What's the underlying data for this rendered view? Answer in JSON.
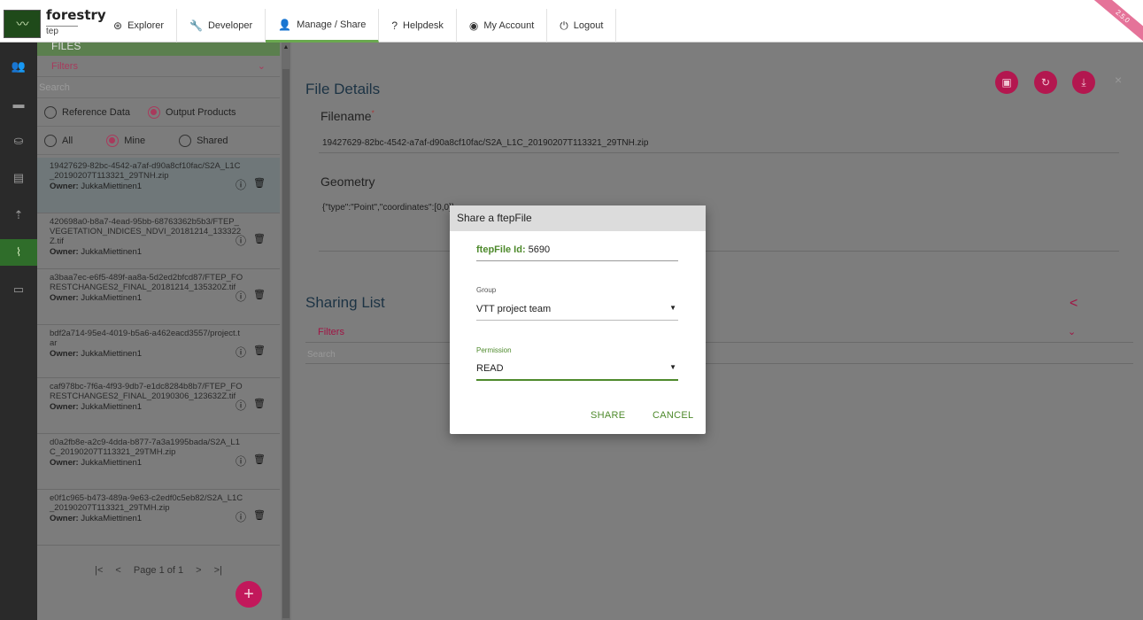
{
  "brand": {
    "logo": "〰",
    "name": "forestry",
    "sub": "tep"
  },
  "nav": [
    {
      "icon": "compass-icon",
      "glyph": "⊛",
      "label": "Explorer",
      "active": false
    },
    {
      "icon": "wrench-icon",
      "glyph": "🔧",
      "label": "Developer",
      "active": false
    },
    {
      "icon": "user-icon",
      "glyph": "👤",
      "label": "Manage / Share",
      "active": true
    },
    {
      "icon": "help-icon",
      "glyph": "?",
      "label": "Helpdesk",
      "active": false
    },
    {
      "icon": "account-icon",
      "glyph": "◉",
      "label": "My Account",
      "active": false
    },
    {
      "icon": "power-icon",
      "glyph": "⏻",
      "label": "Logout",
      "active": false
    }
  ],
  "version": "2.5.0",
  "rail": [
    {
      "icon": "groups-icon",
      "glyph": "👥"
    },
    {
      "icon": "folder-icon",
      "glyph": "▬"
    },
    {
      "icon": "basket-icon",
      "glyph": "⛀"
    },
    {
      "icon": "clipboard-icon",
      "glyph": "▤"
    },
    {
      "icon": "antenna-icon",
      "glyph": "⇡"
    },
    {
      "icon": "paperclip-icon",
      "glyph": "⌇",
      "active": true
    },
    {
      "icon": "chat-icon",
      "glyph": "▭"
    }
  ],
  "files": {
    "header": "FILES",
    "filters_label": "Filters",
    "search_placeholder": "Search",
    "type_options": [
      {
        "label": "Reference Data",
        "checked": false
      },
      {
        "label": "Output Products",
        "checked": true
      }
    ],
    "owner_options": [
      {
        "label": "All",
        "checked": false
      },
      {
        "label": "Mine",
        "checked": true
      },
      {
        "label": "Shared",
        "checked": false
      }
    ],
    "owner_prefix": "Owner:",
    "items": [
      {
        "name": "19427629-82bc-4542-a7af-d90a8cf10fac/S2A_L1C_20190207T113321_29TNH.zip",
        "owner": "JukkaMiettinen1",
        "selected": true
      },
      {
        "name": "420698a0-b8a7-4ead-95bb-68763362b5b3/FTEP_VEGETATION_INDICES_NDVI_20181214_133322Z.tif",
        "owner": "JukkaMiettinen1",
        "selected": false
      },
      {
        "name": "a3baa7ec-e6f5-489f-aa8a-5d2ed2bfcd87/FTEP_FORESTCHANGES2_FINAL_20181214_135320Z.tif",
        "owner": "JukkaMiettinen1",
        "selected": false
      },
      {
        "name": "bdf2a714-95e4-4019-b5a6-a462eacd3557/project.tar",
        "owner": "JukkaMiettinen1",
        "selected": false
      },
      {
        "name": "caf978bc-7f6a-4f93-9db7-e1dc8284b8b7/FTEP_FORESTCHANGES2_FINAL_20190306_123632Z.tif",
        "owner": "JukkaMiettinen1",
        "selected": false
      },
      {
        "name": "d0a2fb8e-a2c9-4dda-b877-7a3a1995bada/S2A_L1C_20190207T113321_29TMH.zip",
        "owner": "JukkaMiettinen1",
        "selected": false
      },
      {
        "name": "e0f1c965-b473-489a-9e63-c2edf0c5eb82/S2A_L1C_20190207T113321_29TMH.zip",
        "owner": "JukkaMiettinen1",
        "selected": false
      }
    ],
    "pager": {
      "first": "|<",
      "prev": "<",
      "page_text": "Page 1 of 1",
      "next": ">",
      "last": ">|"
    },
    "add_glyph": "+"
  },
  "details": {
    "title": "File Details",
    "filename_label": "Filename",
    "required_mark": "*",
    "filename_value": "19427629-82bc-4542-a7af-d90a8cf10fac/S2A_L1C_20190207T113321_29TNH.zip",
    "geometry_label": "Geometry",
    "geometry_value": "{\"type\":\"Point\",\"coordinates\":[0,0]}",
    "sharing_title": "Sharing List",
    "sharing_filters": "Filters",
    "sharing_search": "Search",
    "close_glyph": "×"
  },
  "modal": {
    "title": "Share a ftepFile",
    "id_label": "ftepFile Id:",
    "id_value": "5690",
    "group_label": "Group",
    "group_value": "VTT project team",
    "permission_label": "Permission",
    "permission_value": "READ",
    "share_label": "SHARE",
    "cancel_label": "CANCEL"
  }
}
